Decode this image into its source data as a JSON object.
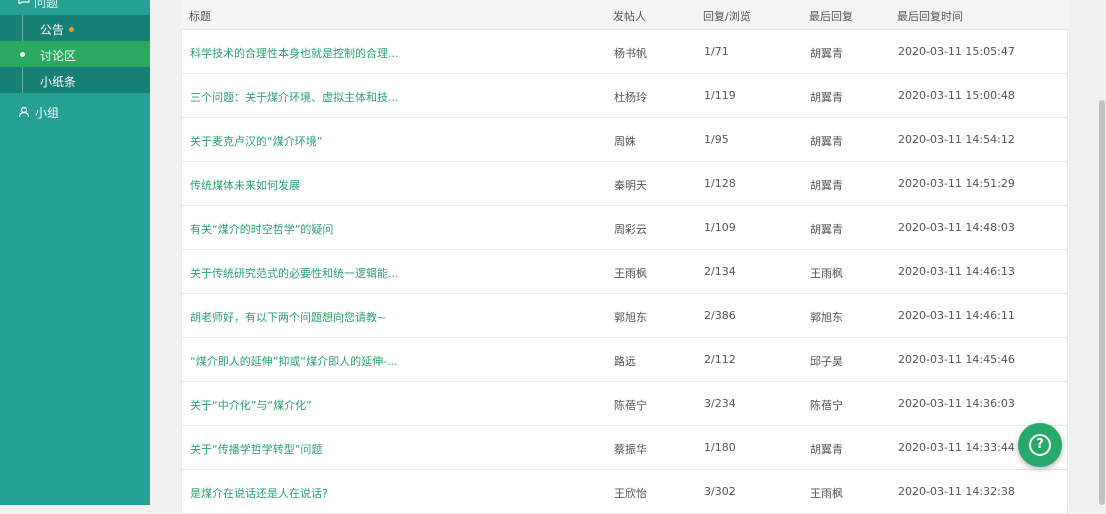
{
  "sidebar": {
    "section_label": "问题",
    "items": [
      {
        "label": "公告"
      },
      {
        "label": "讨论区"
      },
      {
        "label": "小纸条"
      }
    ],
    "group_label": "小组"
  },
  "table": {
    "headers": {
      "title": "标题",
      "author": "发帖人",
      "stats": "回复/浏览",
      "last_reply": "最后回复",
      "last_time": "最后回复时间"
    },
    "rows": [
      {
        "title": "科学技术的合理性本身也就是控制的合理...",
        "author": "杨书帆",
        "stats": "1/71",
        "last_reply": "胡翼青",
        "time": "2020-03-11 15:05:47"
      },
      {
        "title": "三个问题：关于煤介环境、虚拟主体和技...",
        "author": "杜杨玲",
        "stats": "1/119",
        "last_reply": "胡翼青",
        "time": "2020-03-11 15:00:48"
      },
      {
        "title": "关于麦克卢汉的“煤介环境”",
        "author": "周姝",
        "stats": "1/95",
        "last_reply": "胡翼青",
        "time": "2020-03-11 14:54:12"
      },
      {
        "title": "传统煤体未来如何发展",
        "author": "秦明天",
        "stats": "1/128",
        "last_reply": "胡翼青",
        "time": "2020-03-11 14:51:29"
      },
      {
        "title": "有关“煤介的时空哲学”的疑问",
        "author": "周彩云",
        "stats": "1/109",
        "last_reply": "胡翼青",
        "time": "2020-03-11 14:48:03"
      },
      {
        "title": "关于传统研究范式的必要性和统一逻辑能...",
        "author": "王雨枫",
        "stats": "2/134",
        "last_reply": "王雨枫",
        "time": "2020-03-11 14:46:13"
      },
      {
        "title": "胡老师好，有以下两个问题想向您请教~",
        "author": "郭旭东",
        "stats": "2/386",
        "last_reply": "郭旭东",
        "time": "2020-03-11 14:46:11"
      },
      {
        "title": "“煤介即人的延伸”抑或“煤介即人的延伸-...",
        "author": "路远",
        "stats": "2/112",
        "last_reply": "邱子昊",
        "time": "2020-03-11 14:45:46"
      },
      {
        "title": "关于“中介化”与“煤介化”",
        "author": "陈蓓宁",
        "stats": "3/234",
        "last_reply": "陈蓓宁",
        "time": "2020-03-11 14:36:03"
      },
      {
        "title": "关于“传播学哲学转型”问题",
        "author": "蔡振华",
        "stats": "1/180",
        "last_reply": "胡翼青",
        "time": "2020-03-11 14:33:44"
      },
      {
        "title": "是煤介在说话还是人在说话?",
        "author": "王欣怡",
        "stats": "3/302",
        "last_reply": "王雨枫",
        "time": "2020-03-11 14:32:38"
      }
    ]
  },
  "help_button": {
    "icon": "question-icon",
    "glyph": "?"
  },
  "colors": {
    "sidebar": "#24a094",
    "active": "#2aaa60",
    "link": "#2aa36a",
    "badge": "#f39c12"
  }
}
